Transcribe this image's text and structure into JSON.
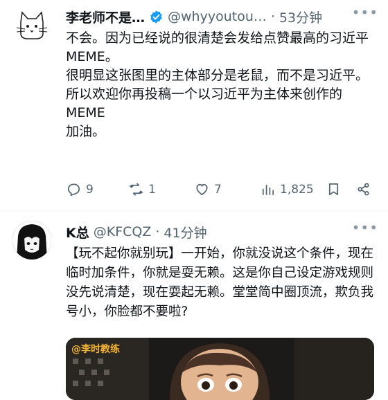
{
  "tweet1": {
    "name": "李老师不是…",
    "handle": "@whyyoutou…",
    "dot": "·",
    "time": "53分钟",
    "lines": [
      "不会。因为已经说的很清楚会发给点赞最高的习近平MEME。",
      "很明显这张图里的主体部分是老鼠，而不是习近平。",
      "所以欢迎你再投稿一个以习近平为主体来创作的MEME",
      "加油。"
    ],
    "actions": {
      "reply_icon": "reply-icon",
      "reply_count": "9",
      "retweet_icon": "retweet-icon",
      "retweet_count": "1",
      "like_icon": "heart-icon",
      "like_count": "7",
      "views_icon": "views-icon",
      "views_count": "1,825",
      "bookmark_icon": "bookmark-icon",
      "share_icon": "share-icon"
    }
  },
  "tweet2": {
    "name": "K总",
    "handle": "@KFCQZ",
    "dot": "·",
    "time": "41分钟",
    "text": "【玩不起你就别玩】一开始，你就没说这个条件，现在临时加条件，你就是耍无赖。这是你自己设定游戏规则没先说清楚，现在耍起无赖。堂堂简中圈顶流，欺负我号小，你脸都不要啦?",
    "media_watermark": "@李时教练"
  },
  "colors": {
    "text": "#0f1419",
    "secondary": "#536471",
    "verified": "#1d9bf0",
    "divider": "#eff3f4"
  }
}
